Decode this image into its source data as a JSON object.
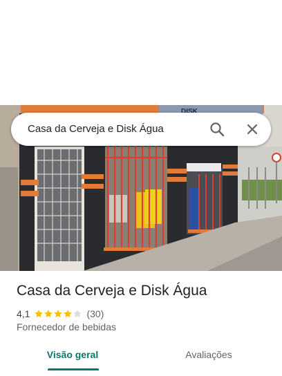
{
  "search": {
    "query": "Casa da Cerveja e Disk Água",
    "search_icon": "search-icon",
    "close_icon": "close-icon"
  },
  "photo": {
    "sign_text": "DISK"
  },
  "place": {
    "title": "Casa da Cerveja e Disk Água",
    "rating": "4,1",
    "stars": 4.1,
    "review_count": "(30)",
    "category": "Fornecedor de bebidas"
  },
  "tabs": [
    {
      "label": "Visão geral",
      "selected": true
    },
    {
      "label": "Avaliações",
      "selected": false
    }
  ],
  "colors": {
    "accent": "#00796b",
    "star": "#fbbc04",
    "star_empty": "#dadce0"
  }
}
